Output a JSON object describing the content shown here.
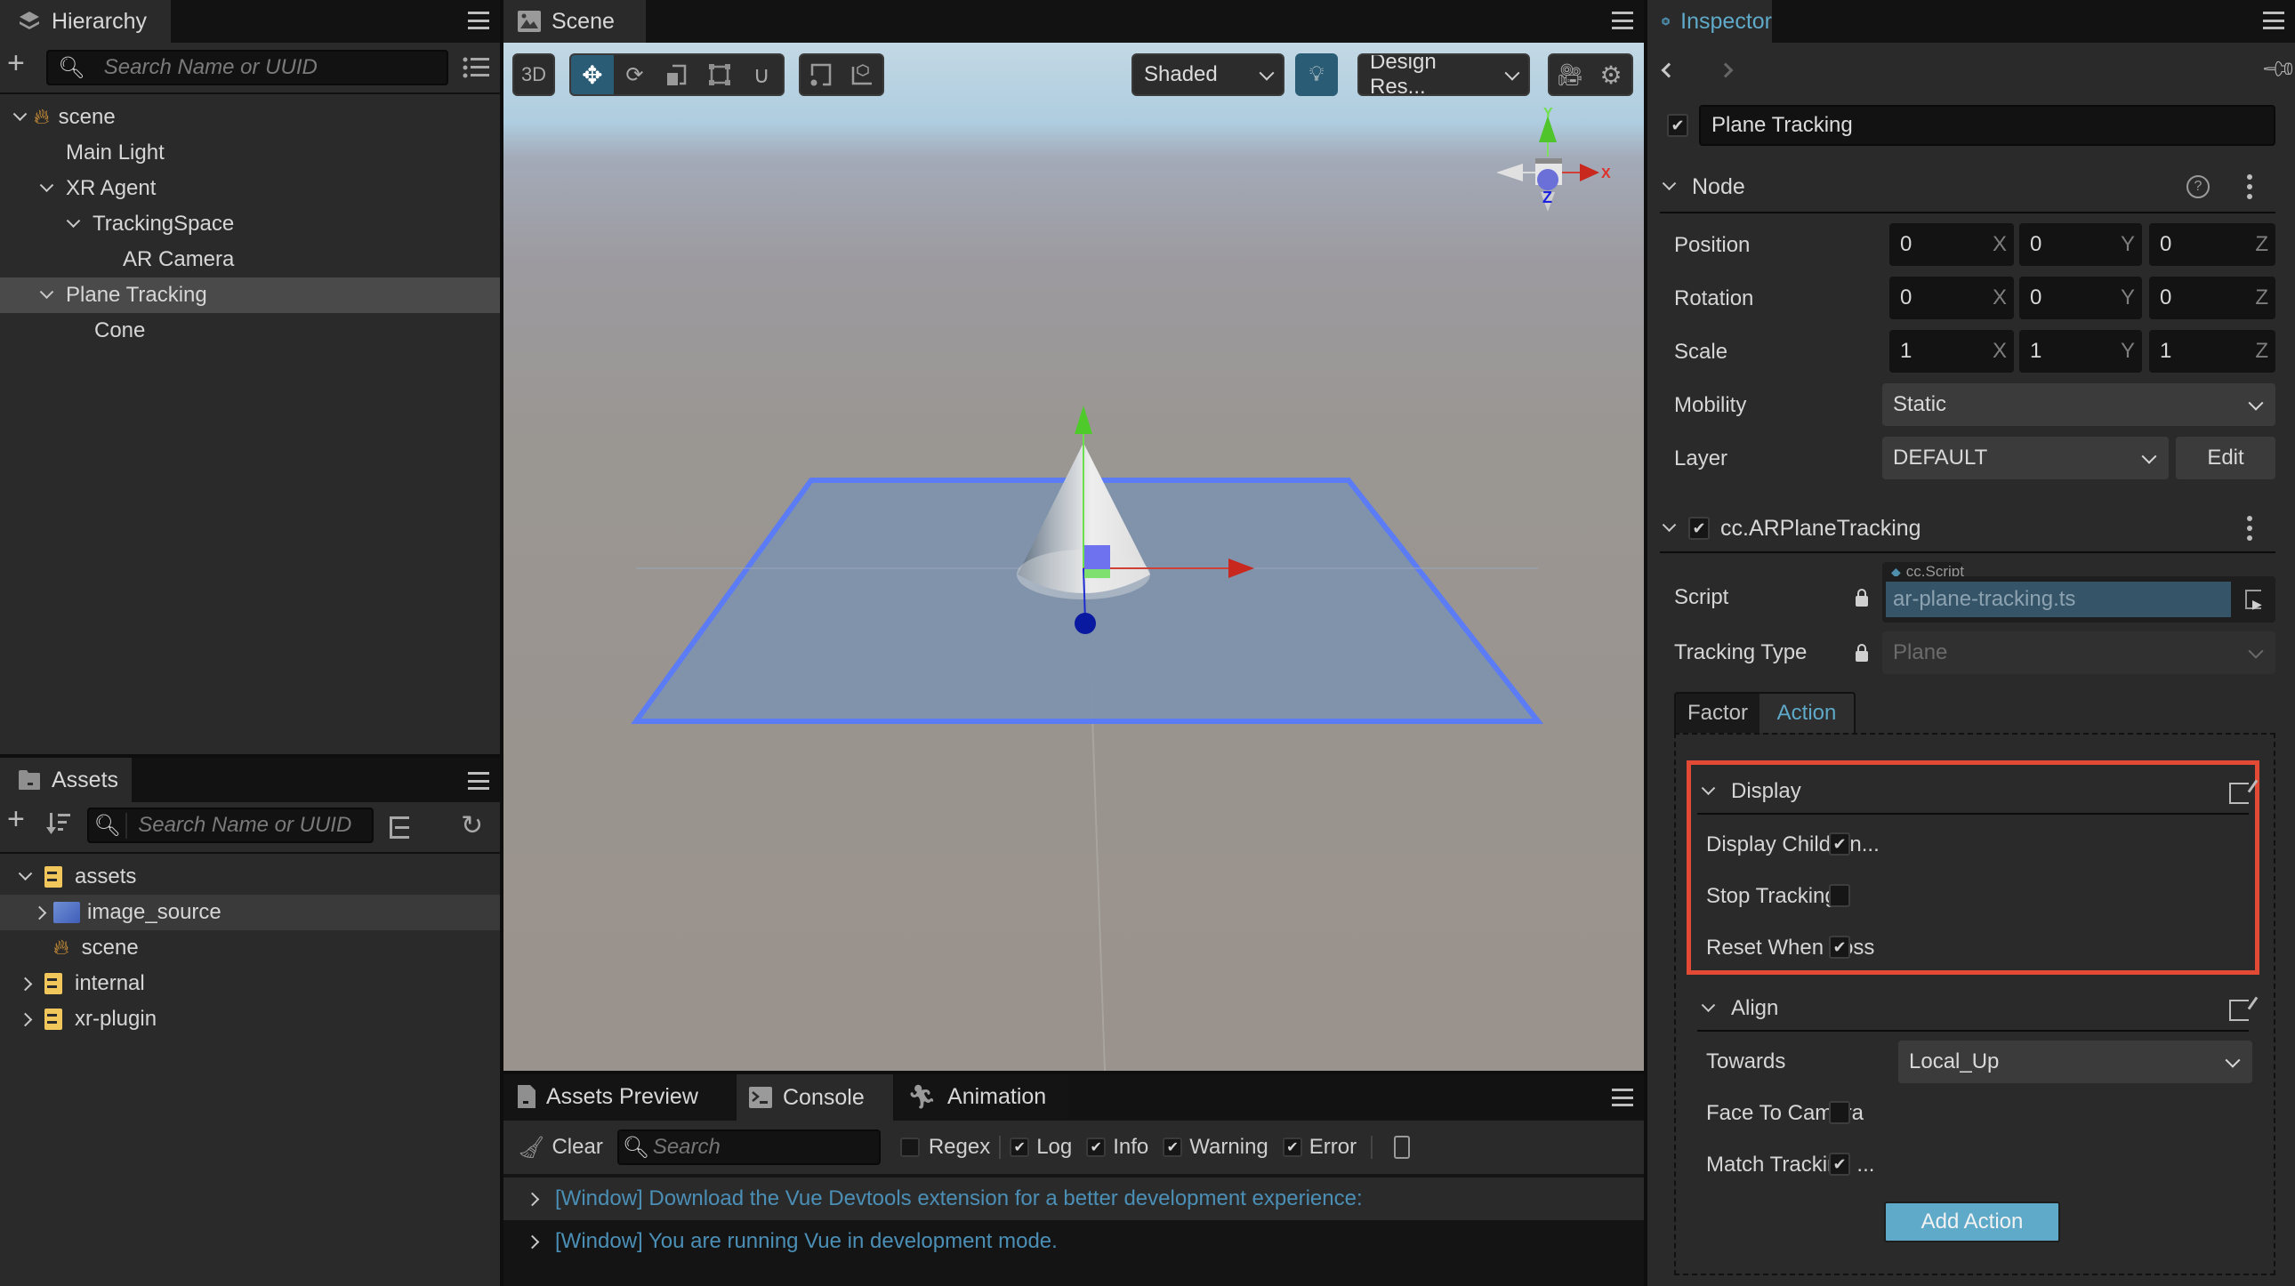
{
  "hierarchy": {
    "title": "Hierarchy",
    "search_placeholder": "Search Name or UUID",
    "items": [
      {
        "label": "scene",
        "depth": 0,
        "expanded": true,
        "icon": "scene-flame-icon"
      },
      {
        "label": "Main Light",
        "depth": 1
      },
      {
        "label": "XR Agent",
        "depth": 1,
        "expanded": true
      },
      {
        "label": "TrackingSpace",
        "depth": 2,
        "expanded": true
      },
      {
        "label": "AR Camera",
        "depth": 3
      },
      {
        "label": "Plane Tracking",
        "depth": 1,
        "expanded": true,
        "selected": true
      },
      {
        "label": "Cone",
        "depth": 2
      }
    ]
  },
  "assets": {
    "title": "Assets",
    "search_placeholder": "Search Name or UUID",
    "items": [
      {
        "label": "assets",
        "depth": 0,
        "expanded": true,
        "icon": "database-folder-icon"
      },
      {
        "label": "image_source",
        "depth": 1,
        "expanded": false,
        "icon": "image-folder-icon",
        "highlighted": true
      },
      {
        "label": "scene",
        "depth": 1,
        "icon": "scene-flame-icon"
      },
      {
        "label": "internal",
        "depth": 0,
        "expanded": false,
        "icon": "database-folder-icon"
      },
      {
        "label": "xr-plugin",
        "depth": 0,
        "expanded": false,
        "icon": "database-folder-icon"
      }
    ]
  },
  "scene": {
    "title": "Scene",
    "toolbar": {
      "mode_3d": "3D",
      "shading": "Shaded",
      "resolution": "Design Res...",
      "tools": [
        "move",
        "rotate",
        "scale",
        "rect",
        "snap"
      ],
      "active_tool": "move"
    },
    "gizmo_axes": [
      "Y",
      "X",
      "Z"
    ]
  },
  "bottom_panel": {
    "tabs": [
      "Assets Preview",
      "Console",
      "Animation"
    ],
    "active_tab": "Console",
    "clear_label": "Clear",
    "search_placeholder": "Search",
    "filters": [
      {
        "label": "Regex",
        "checked": false
      },
      {
        "label": "Log",
        "checked": true
      },
      {
        "label": "Info",
        "checked": true
      },
      {
        "label": "Warning",
        "checked": true
      },
      {
        "label": "Error",
        "checked": true
      }
    ],
    "messages": [
      "[Window] Download the Vue Devtools extension for a better development experience:",
      "[Window] You are running Vue in development mode."
    ]
  },
  "inspector": {
    "title": "Inspector",
    "node_name": "Plane Tracking",
    "node_active": true,
    "node_section": {
      "title": "Node",
      "position": {
        "label": "Position",
        "x": "0",
        "y": "0",
        "z": "0"
      },
      "rotation": {
        "label": "Rotation",
        "x": "0",
        "y": "0",
        "z": "0"
      },
      "scale": {
        "label": "Scale",
        "x": "1",
        "y": "1",
        "z": "1"
      },
      "mobility": {
        "label": "Mobility",
        "value": "Static"
      },
      "layer": {
        "label": "Layer",
        "value": "DEFAULT",
        "edit_label": "Edit"
      }
    },
    "axis_labels": {
      "x": "X",
      "y": "Y",
      "z": "Z"
    },
    "component": {
      "title": "cc.ARPlaneTracking",
      "enabled": true,
      "script": {
        "label": "Script",
        "type_tag": "cc.Script",
        "value": "ar-plane-tracking.ts"
      },
      "tracking_type": {
        "label": "Tracking Type",
        "value": "Plane"
      },
      "tabs": [
        "Factor",
        "Action"
      ],
      "active_tab": "Action",
      "display": {
        "title": "Display",
        "props": [
          {
            "label": "Display Children...",
            "checked": true
          },
          {
            "label": "Stop Tracking",
            "checked": false
          },
          {
            "label": "Reset When Loss",
            "checked": true
          }
        ]
      },
      "align": {
        "title": "Align",
        "towards": {
          "label": "Towards",
          "value": "Local_Up"
        },
        "props": [
          {
            "label": "Face To Camera",
            "checked": false
          },
          {
            "label": "Match Tracking ...",
            "checked": true
          }
        ]
      },
      "add_action_label": "Add Action"
    }
  },
  "colors": {
    "accent": "#5fa9c9",
    "active_tool_bg": "#2a5d75",
    "highlight_box": "#e24a35",
    "console_text": "#4b8fb6",
    "plane_edge": "#5b7cf5"
  }
}
